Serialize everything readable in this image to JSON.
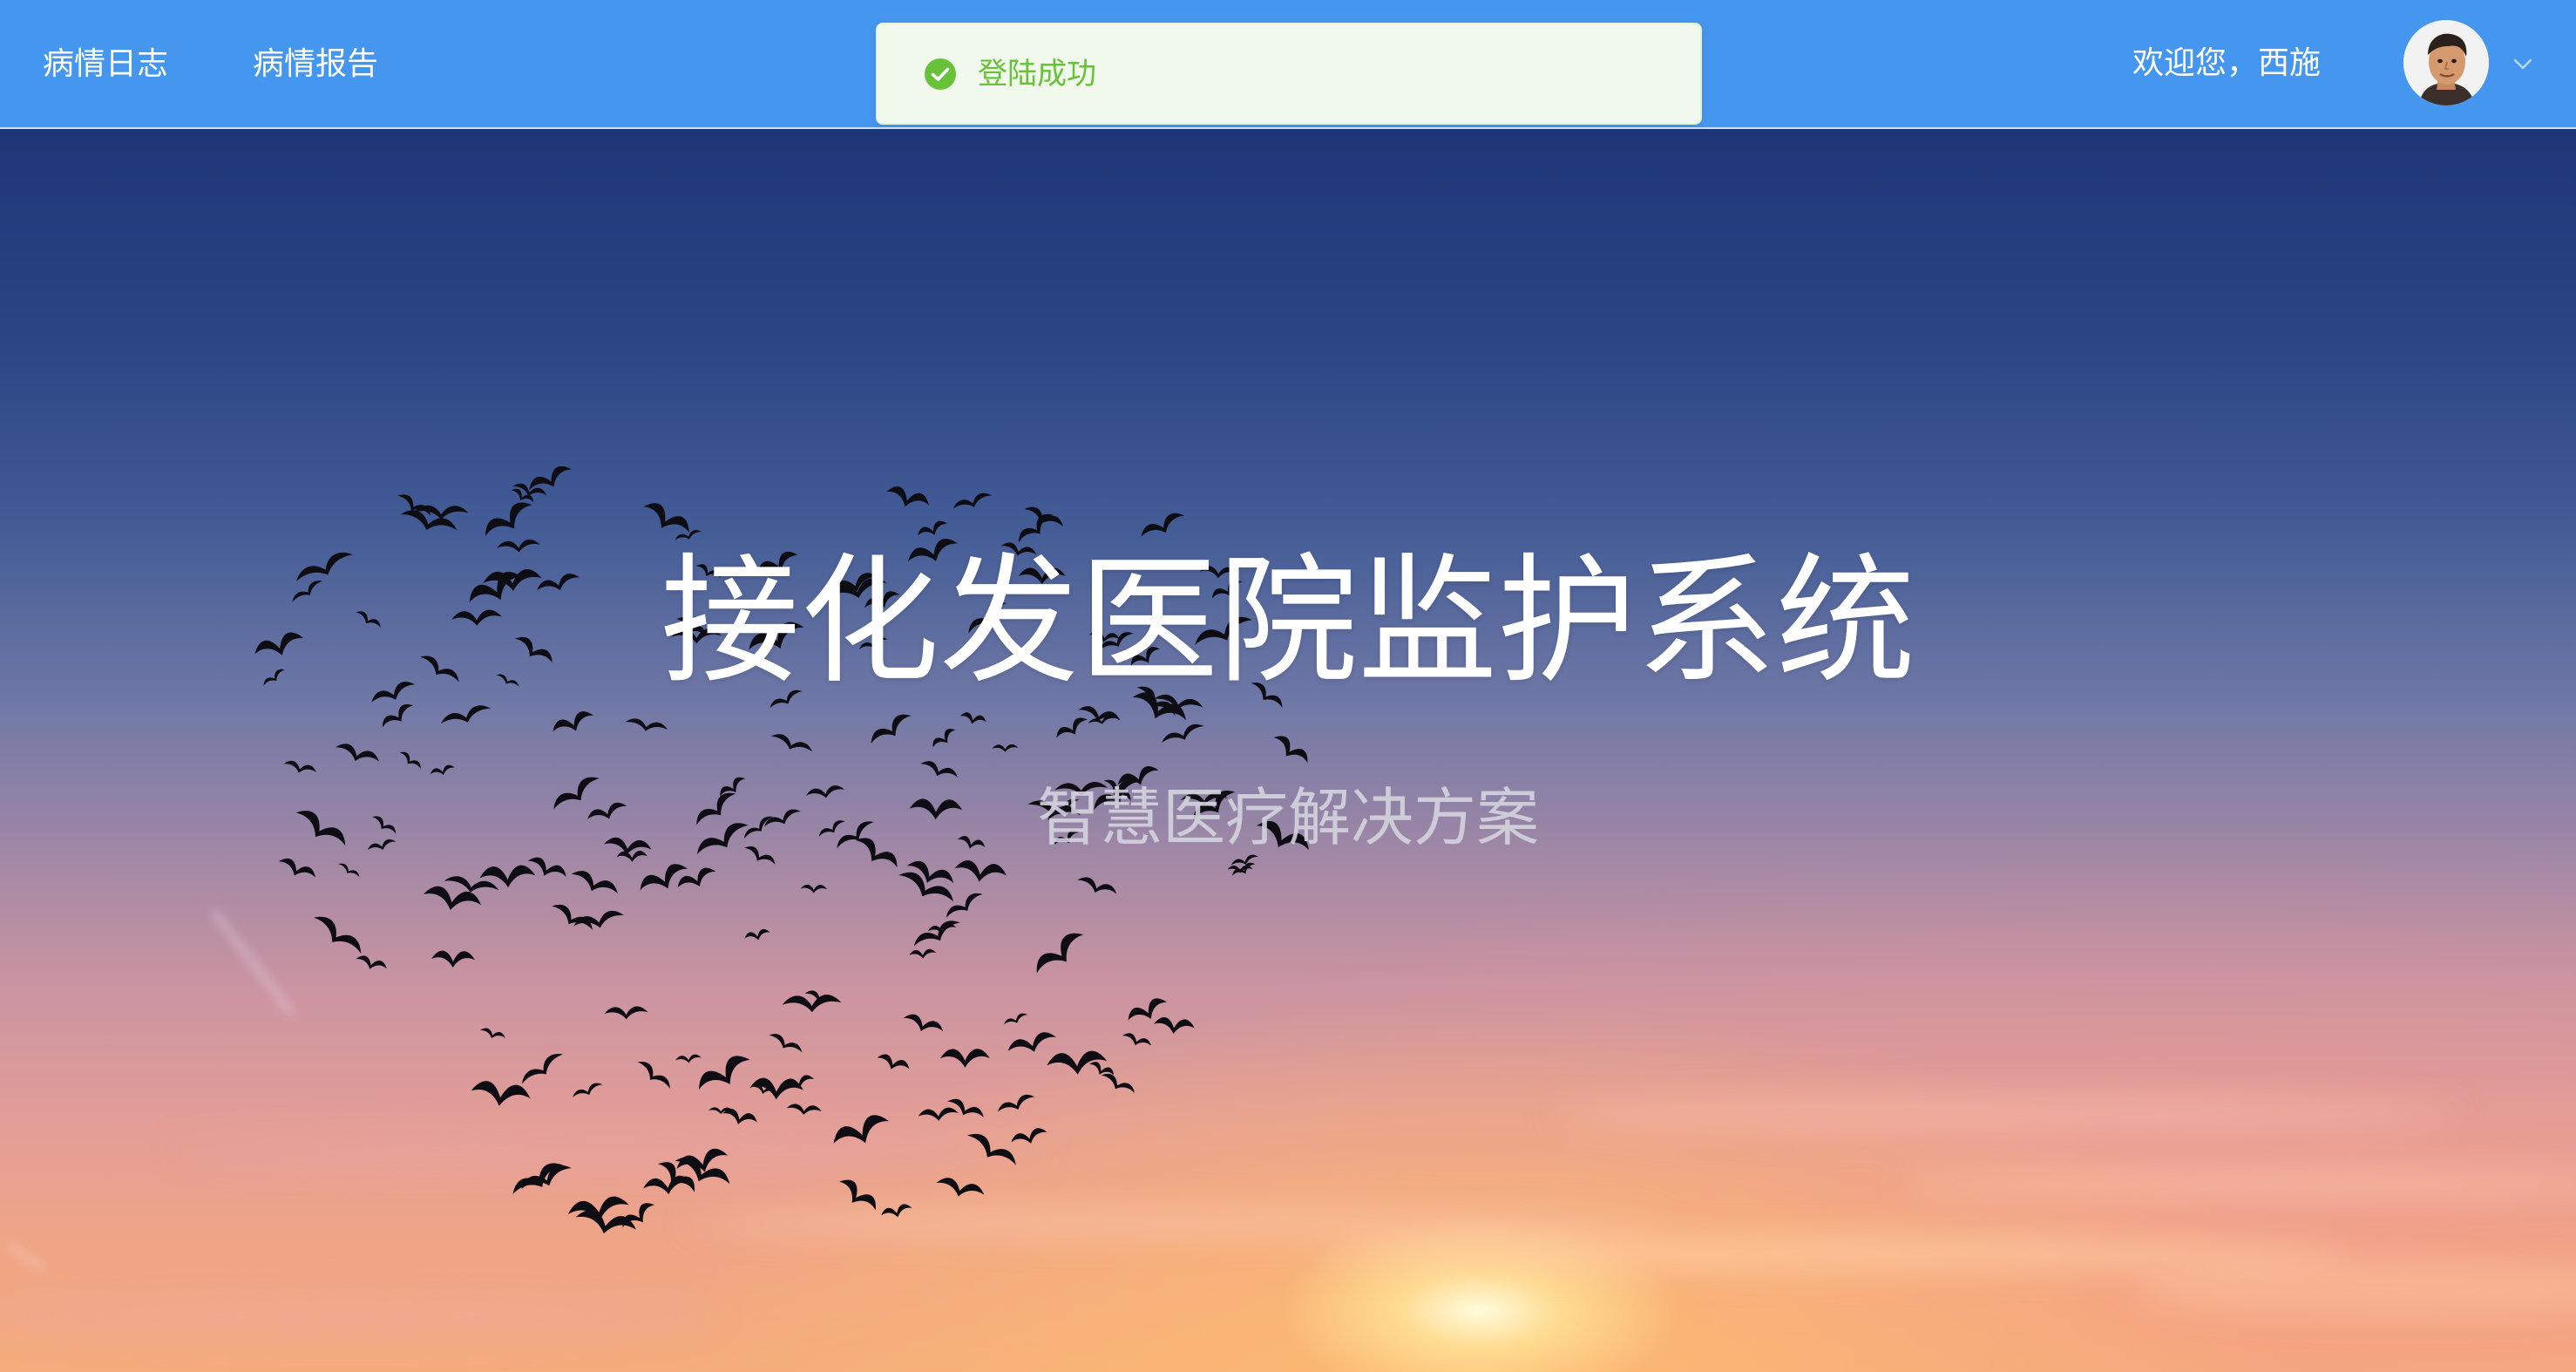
{
  "header": {
    "nav": [
      {
        "label": "病情日志"
      },
      {
        "label": "病情报告"
      }
    ],
    "welcome": "欢迎您，西施",
    "avatar_icon": "user-avatar",
    "dropdown_icon": "chevron-down-icon"
  },
  "toast": {
    "type": "success",
    "icon": "check-circle-icon",
    "message": "登陆成功"
  },
  "hero": {
    "title": "接化发医院监护系统",
    "subtitle": "智慧医疗解决方案",
    "background": "sunset-sky-with-heart-of-birds"
  },
  "colors": {
    "header_bg": "#4596ee",
    "toast_bg": "#f0f9eb",
    "toast_border": "#e1f3d8",
    "success": "#67c23a",
    "title_text": "#ffffff"
  }
}
